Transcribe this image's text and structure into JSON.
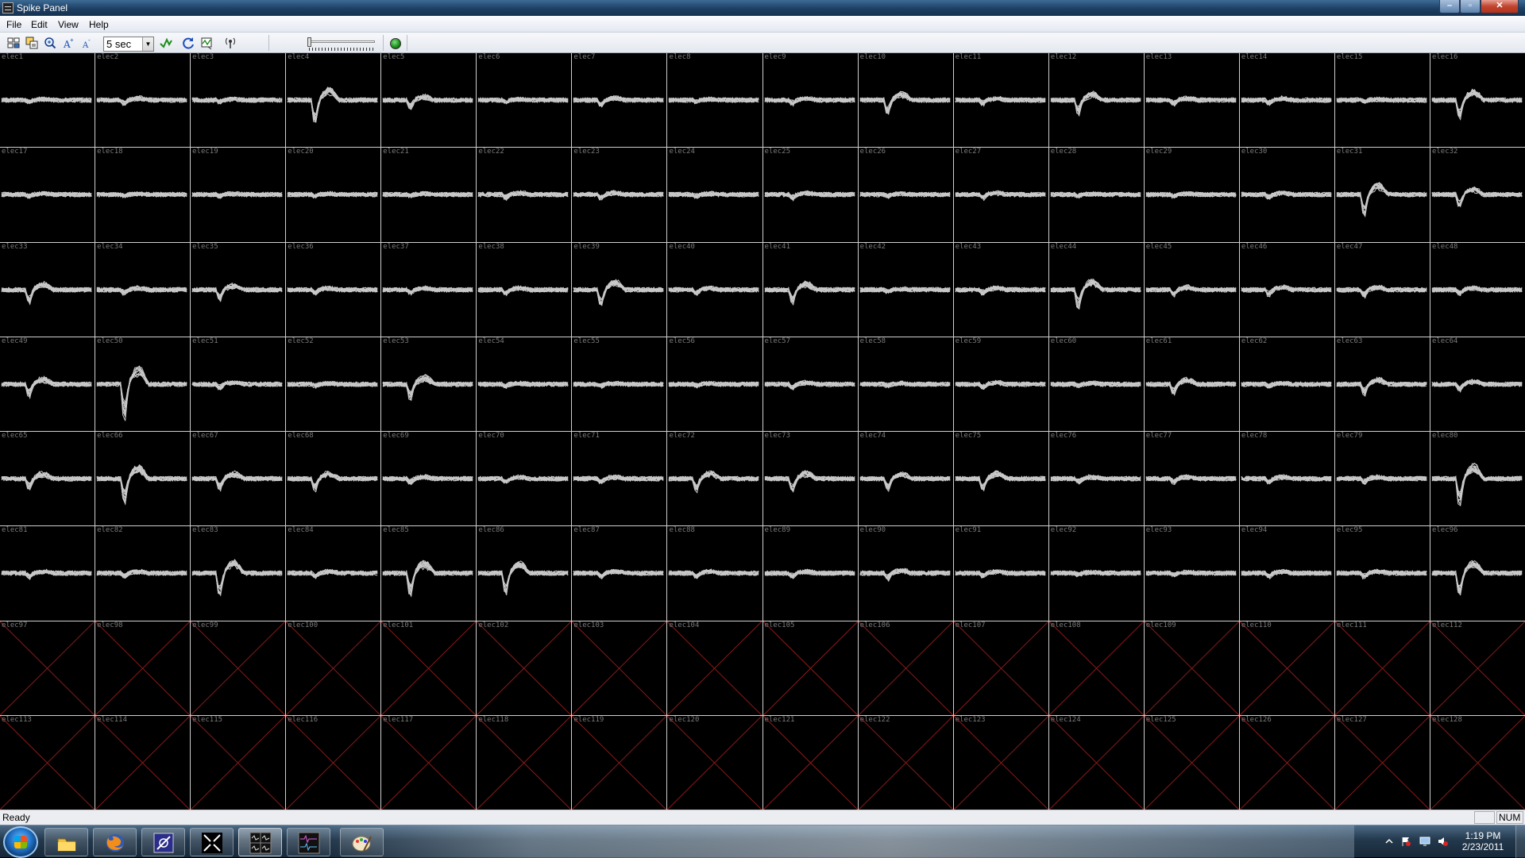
{
  "window": {
    "title": "Spike Panel"
  },
  "menu": [
    "File",
    "Edit",
    "View",
    "Help"
  ],
  "toolbar": {
    "interval": "5 sec",
    "run_indicator_color": "#1a9a1a"
  },
  "panel": {
    "columns": 16,
    "rows": 8,
    "electrodes": [
      "elec1",
      "elec2",
      "elec3",
      "elec4",
      "elec5",
      "elec6",
      "elec7",
      "elec8",
      "elec9",
      "elec10",
      "elec11",
      "elec12",
      "elec13",
      "elec14",
      "elec15",
      "elec16",
      "elec17",
      "elec18",
      "elec19",
      "elec20",
      "elec21",
      "elec22",
      "elec23",
      "elec24",
      "elec25",
      "elec26",
      "elec27",
      "elec28",
      "elec29",
      "elec30",
      "elec31",
      "elec32",
      "elec33",
      "elec34",
      "elec35",
      "elec36",
      "elec37",
      "elec38",
      "elec39",
      "elec40",
      "elec41",
      "elec42",
      "elec43",
      "elec44",
      "elec45",
      "elec46",
      "elec47",
      "elec48",
      "elec49",
      "elec50",
      "elec51",
      "elec52",
      "elec53",
      "elec54",
      "elec55",
      "elec56",
      "elec57",
      "elec58",
      "elec59",
      "elec60",
      "elec61",
      "elec62",
      "elec63",
      "elec64",
      "elec65",
      "elec66",
      "elec67",
      "elec68",
      "elec69",
      "elec70",
      "elec71",
      "elec72",
      "elec73",
      "elec74",
      "elec75",
      "elec76",
      "elec77",
      "elec78",
      "elec79",
      "elec80",
      "elec81",
      "elec82",
      "elec83",
      "elec84",
      "elec85",
      "elec86",
      "elec87",
      "elec88",
      "elec89",
      "elec90",
      "elec91",
      "elec92",
      "elec93",
      "elec94",
      "elec95",
      "elec96",
      "elec97",
      "elec98",
      "elec99",
      "elec100",
      "elec101",
      "elec102",
      "elec103",
      "elec104",
      "elec105",
      "elec106",
      "elec107",
      "elec108",
      "elec109",
      "elec110",
      "elec111",
      "elec112",
      "elec113",
      "elec114",
      "elec115",
      "elec116",
      "elec117",
      "elec118",
      "elec119",
      "elec120",
      "elec121",
      "elec122",
      "elec123",
      "elec124",
      "elec125",
      "elec126",
      "elec127",
      "elec128"
    ],
    "active_count": 96,
    "waveform_color": "#c8c8c8",
    "inactive_cross_color": "#8a1a1a",
    "label_color": "#7a7a7a"
  },
  "statusbar": {
    "text": "Ready",
    "num_indicator": "NUM"
  },
  "taskbar": {
    "apps": [
      "windows-explorer-icon",
      "firefox-icon",
      "neuroport-icon",
      "raster-icon",
      "spike-panel-icon",
      "oscilloscope-icon",
      "paint-icon"
    ],
    "clock_time": "1:19 PM",
    "clock_date": "2/23/2011"
  }
}
